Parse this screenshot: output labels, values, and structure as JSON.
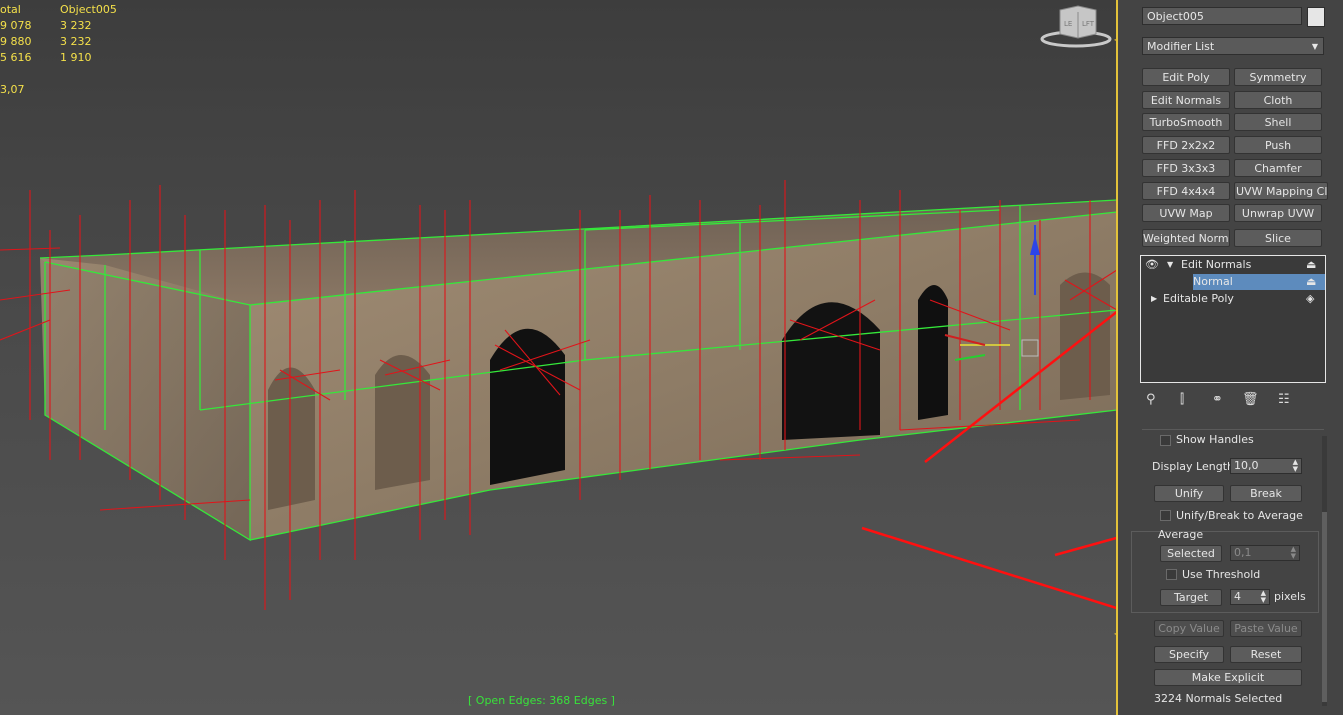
{
  "stats": {
    "header": [
      "otal",
      "Object005"
    ],
    "rows": [
      [
        "9 078",
        "3 232"
      ],
      [
        "9 880",
        "3 232"
      ],
      [
        "5 616",
        "1 910"
      ]
    ],
    "extra": "3,07"
  },
  "viewport": {
    "status": "[ Open Edges: 368 Edges ]",
    "viewcube": {
      "left": "LE",
      "front": "LFT"
    }
  },
  "panel": {
    "object_name": "Object005",
    "modifier_list": "Modifier List",
    "modifiers": [
      "Edit Poly",
      "Symmetry",
      "Edit Normals",
      "Cloth",
      "TurboSmooth",
      "Shell",
      "FFD 2x2x2",
      "Push",
      "FFD 3x3x3",
      "Chamfer",
      "FFD 4x4x4",
      "UVW Mapping Clea",
      "UVW Map",
      "Unwrap UVW",
      "Weighted Normals",
      "Slice"
    ],
    "stack": {
      "item1": "Edit Normals",
      "sub": "Normal",
      "item2": "Editable Poly"
    },
    "show_handles": "Show Handles",
    "display_length_label": "Display Length:",
    "display_length": "10,0",
    "unify": "Unify",
    "break": "Break",
    "unify_break_avg": "Unify/Break to Average",
    "average_title": "Average",
    "selected": "Selected",
    "selected_value": "0,1",
    "use_threshold": "Use Threshold",
    "target": "Target",
    "target_value": "4",
    "pixels": "pixels",
    "copy_value": "Copy Value",
    "paste_value": "Paste Value",
    "specify": "Specify",
    "reset": "Reset",
    "make_explicit": "Make Explicit",
    "status": "3224 Normals Selected"
  }
}
